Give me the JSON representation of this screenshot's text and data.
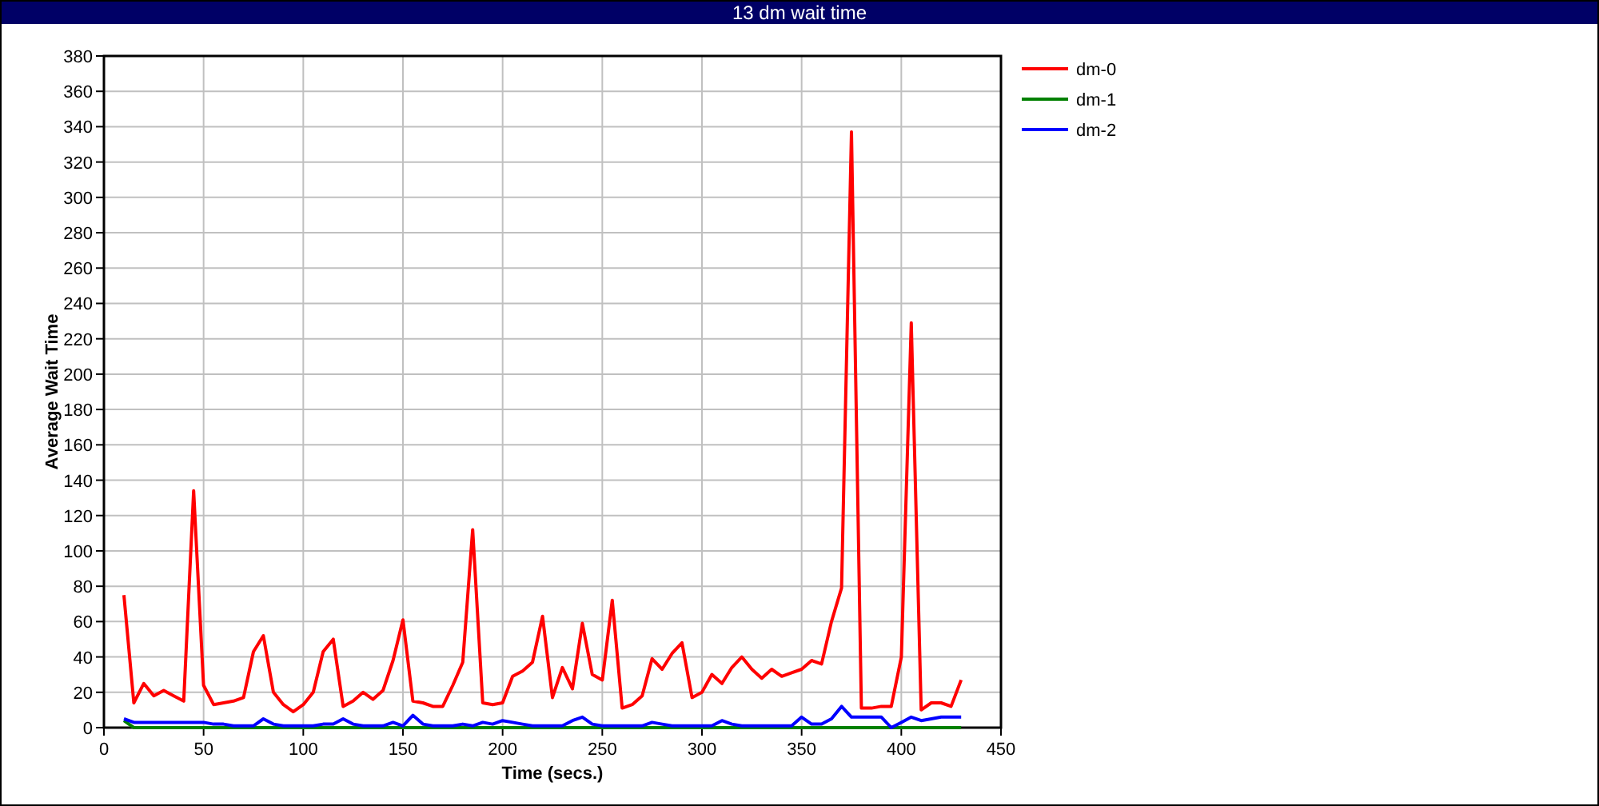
{
  "window": {
    "title": "13 dm wait time"
  },
  "chart_data": {
    "type": "line",
    "grid": true,
    "legend": true,
    "xlabel": "Time (secs.)",
    "ylabel": "Average Wait Time",
    "xlim": [
      0,
      450
    ],
    "ylim": [
      0,
      380
    ],
    "xticks": [
      0,
      50,
      100,
      150,
      200,
      250,
      300,
      350,
      400,
      450
    ],
    "yticks": [
      0,
      20,
      40,
      60,
      80,
      100,
      120,
      140,
      160,
      180,
      200,
      220,
      240,
      260,
      280,
      300,
      320,
      340,
      360,
      380
    ],
    "x": [
      10,
      15,
      20,
      25,
      30,
      35,
      40,
      45,
      50,
      55,
      60,
      65,
      70,
      75,
      80,
      85,
      90,
      95,
      100,
      105,
      110,
      115,
      120,
      125,
      130,
      135,
      140,
      145,
      150,
      155,
      160,
      165,
      170,
      175,
      180,
      185,
      190,
      195,
      200,
      205,
      210,
      215,
      220,
      225,
      230,
      235,
      240,
      245,
      250,
      255,
      260,
      265,
      270,
      275,
      280,
      285,
      290,
      295,
      300,
      305,
      310,
      315,
      320,
      325,
      330,
      335,
      340,
      345,
      350,
      355,
      360,
      365,
      370,
      375,
      380,
      385,
      390,
      395,
      400,
      405,
      410,
      415,
      420,
      425,
      430
    ],
    "series": [
      {
        "name": "dm-0",
        "color": "#ff0000",
        "values": [
          75,
          14,
          25,
          18,
          21,
          18,
          15,
          134,
          24,
          13,
          14,
          15,
          17,
          43,
          52,
          20,
          13,
          9,
          13,
          20,
          43,
          50,
          12,
          15,
          20,
          16,
          21,
          38,
          61,
          15,
          14,
          12,
          12,
          24,
          37,
          112,
          14,
          13,
          14,
          29,
          32,
          37,
          63,
          17,
          34,
          22,
          59,
          30,
          27,
          72,
          11,
          13,
          18,
          39,
          33,
          42,
          48,
          17,
          20,
          30,
          25,
          34,
          40,
          33,
          28,
          33,
          29,
          31,
          33,
          38,
          36,
          60,
          79,
          337,
          11,
          11,
          12,
          12,
          40,
          229,
          10,
          14,
          14,
          12,
          27
        ]
      },
      {
        "name": "dm-1",
        "color": "#008000",
        "values": [
          4,
          0,
          0,
          0,
          0,
          0,
          0,
          0,
          0,
          0,
          0,
          0,
          0,
          0,
          0,
          0,
          0,
          0,
          0,
          0,
          0,
          0,
          0,
          0,
          0,
          0,
          0,
          0,
          0,
          0,
          0,
          0,
          0,
          0,
          0,
          0,
          0,
          0,
          0,
          0,
          0,
          0,
          0,
          0,
          0,
          0,
          0,
          0,
          0,
          0,
          0,
          0,
          0,
          0,
          0,
          0,
          0,
          0,
          0,
          0,
          0,
          0,
          0,
          0,
          0,
          0,
          0,
          0,
          0,
          0,
          0,
          0,
          0,
          0,
          0,
          0,
          0,
          0,
          0,
          0,
          0,
          0,
          0,
          0,
          0
        ]
      },
      {
        "name": "dm-2",
        "color": "#0000ff",
        "values": [
          5,
          3,
          3,
          3,
          3,
          3,
          3,
          3,
          3,
          2,
          2,
          1,
          1,
          1,
          5,
          2,
          1,
          1,
          1,
          1,
          2,
          2,
          5,
          2,
          1,
          1,
          1,
          3,
          1,
          7,
          2,
          1,
          1,
          1,
          2,
          1,
          3,
          2,
          4,
          3,
          2,
          1,
          1,
          1,
          1,
          4,
          6,
          2,
          1,
          1,
          1,
          1,
          1,
          3,
          2,
          1,
          1,
          1,
          1,
          1,
          4,
          2,
          1,
          1,
          1,
          1,
          1,
          1,
          6,
          2,
          2,
          5,
          12,
          6,
          6,
          6,
          6,
          0,
          3,
          6,
          4,
          5,
          6,
          6,
          6
        ]
      }
    ]
  }
}
